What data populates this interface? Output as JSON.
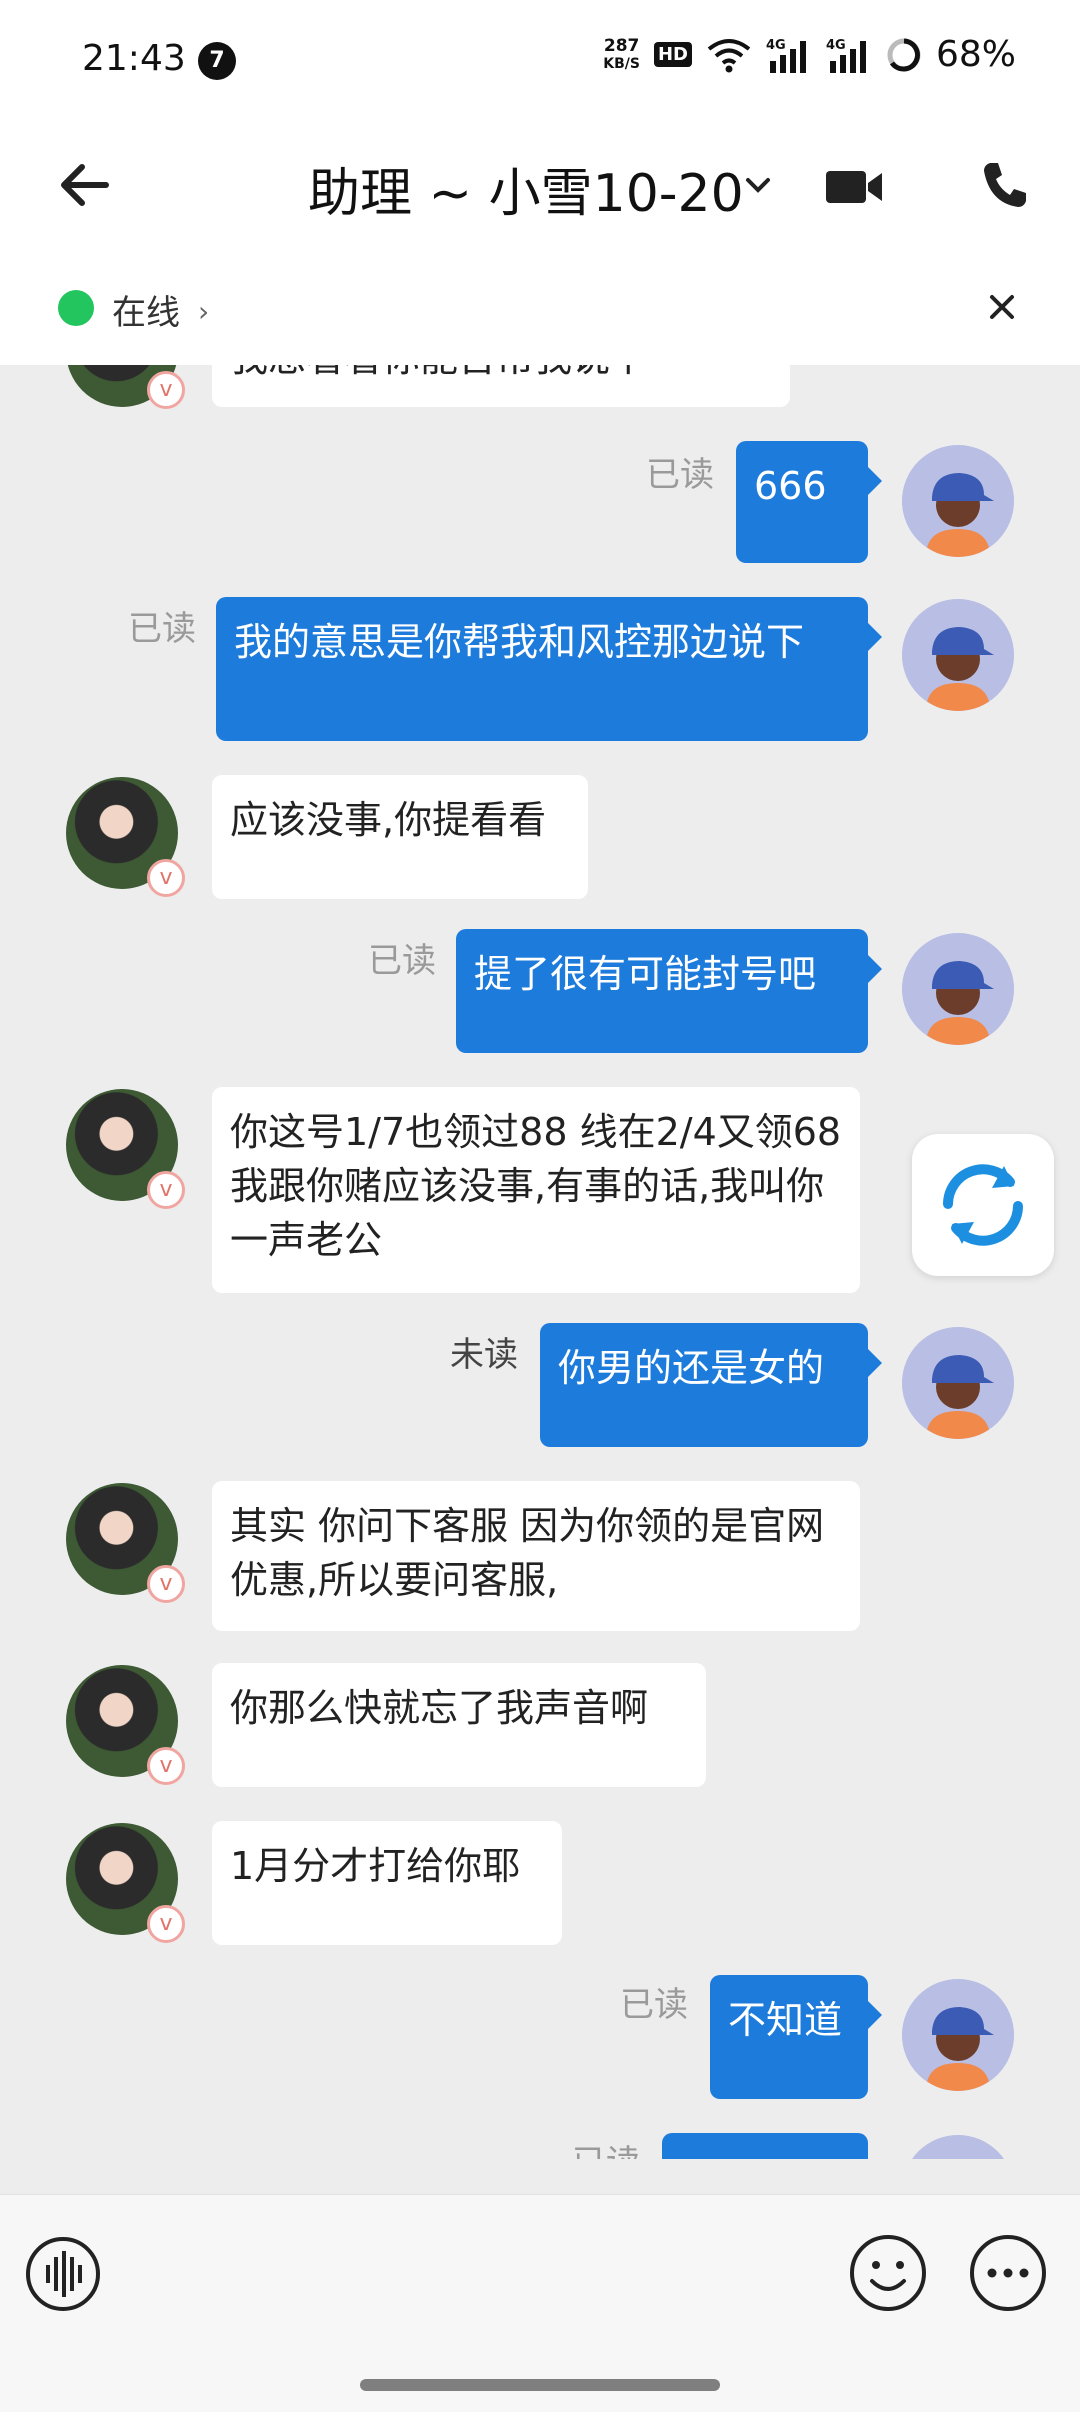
{
  "status_bar": {
    "time": "21:43",
    "notification_count": "7",
    "net_speed_value": "287",
    "net_speed_unit": "KB/S",
    "hd_label": "HD",
    "battery_percent": "68%"
  },
  "header": {
    "title": "助理 ~ 小雪10-20",
    "online_status": "在线"
  },
  "messages": [
    {
      "side": "in",
      "text": "我想看看你能否帮我说下"
    },
    {
      "side": "out",
      "read": "已读",
      "text": "666"
    },
    {
      "side": "out",
      "read": "已读",
      "text": "我的意思是你帮我和风控那边说下"
    },
    {
      "side": "in",
      "text": "应该没事,你提看看"
    },
    {
      "side": "out",
      "read": "已读",
      "text": "提了很有可能封号吧"
    },
    {
      "side": "in",
      "text": "你这号1/7也领过88 线在2/4又领68  我跟你赌应该没事,有事的话,我叫你一声老公"
    },
    {
      "side": "out",
      "read": "未读",
      "text": "你男的还是女的"
    },
    {
      "side": "in",
      "text": "其实 你问下客服  因为你领的是官网优惠,所以要问客服,"
    },
    {
      "side": "in",
      "text": "你那么快就忘了我声音啊"
    },
    {
      "side": "in",
      "text": "1月分才打给你耶"
    },
    {
      "side": "out",
      "read": "已读",
      "text": "不知道"
    },
    {
      "side": "out",
      "read": "已读",
      "text": ""
    }
  ],
  "avatar_badge": "v",
  "colors": {
    "outgoing_bubble": "#1d7bdc",
    "incoming_bubble": "#ffffff",
    "online_dot": "#22c55e"
  },
  "icons": {
    "back": "arrow-left-icon",
    "title_dropdown": "chevron-down-icon",
    "video": "video-camera-icon",
    "phone": "phone-icon",
    "close": "close-icon",
    "refresh": "refresh-icon",
    "voice": "voice-icon",
    "emoji": "emoji-icon",
    "more": "more-icon"
  }
}
